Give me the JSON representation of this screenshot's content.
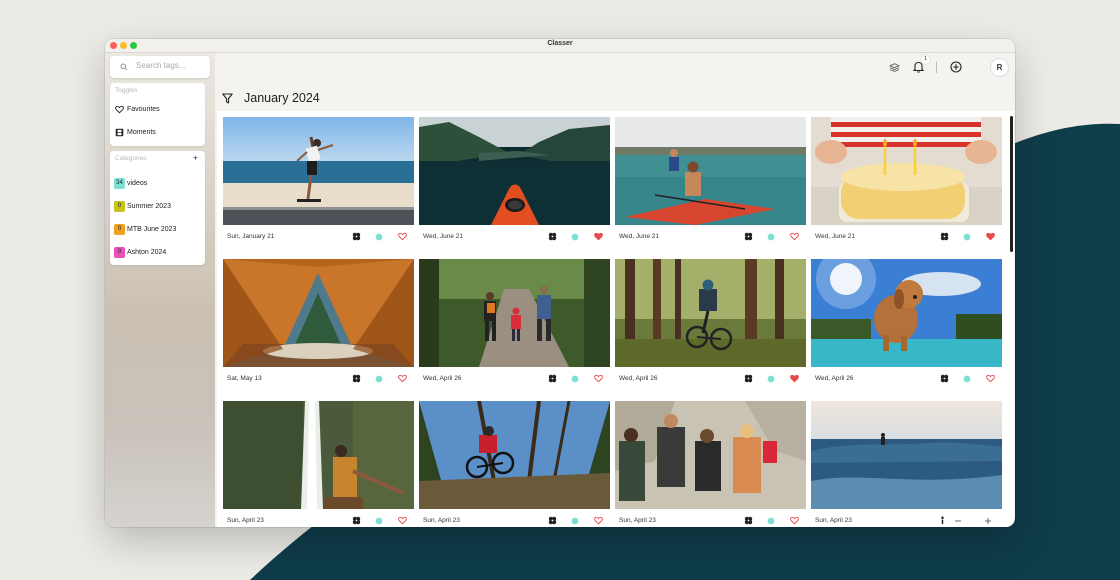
{
  "window": {
    "title": "Classer"
  },
  "search": {
    "placeholder": "Search tags..."
  },
  "toggles": {
    "title": "Toggles",
    "items": [
      {
        "label": "Favourites",
        "icon": "heart-icon"
      },
      {
        "label": "Moments",
        "icon": "film-icon"
      }
    ]
  },
  "categories": {
    "title": "Categories",
    "add_label": "+",
    "items": [
      {
        "count": "34",
        "label": "videos",
        "color": "#7ee0d4"
      },
      {
        "count": "0",
        "label": "Summer 2023",
        "color": "#c9c21a"
      },
      {
        "count": "0",
        "label": "MTB June 2023",
        "color": "#f0a020"
      },
      {
        "count": "0",
        "label": "Ashton 2024",
        "color": "#e84fb8"
      }
    ]
  },
  "topbar": {
    "notification_count": "1",
    "avatar_initial": "R"
  },
  "main": {
    "heading": "January 2024"
  },
  "accent": {
    "teal": "#7ee0d4",
    "heart": "#e84a4a",
    "dark_teal": "#0f3d4a"
  },
  "gallery": {
    "items": [
      {
        "date": "Sun, January 21",
        "favourite": false,
        "scene": "skateboarder-beach"
      },
      {
        "date": "Wed, June 21",
        "favourite": true,
        "scene": "kayak-fjord"
      },
      {
        "date": "Wed, June 21",
        "favourite": false,
        "scene": "paddleboard-family"
      },
      {
        "date": "Wed, June 21",
        "favourite": true,
        "scene": "birthday-cake"
      },
      {
        "date": "Sat, May 13",
        "favourite": false,
        "scene": "tent-forest"
      },
      {
        "date": "Wed, April 26",
        "favourite": false,
        "scene": "family-walk-forest"
      },
      {
        "date": "Wed, April 26",
        "favourite": true,
        "scene": "mtb-forest"
      },
      {
        "date": "Wed, April 26",
        "favourite": false,
        "scene": "dog-pool"
      },
      {
        "date": "Sun, April 23",
        "favourite": false,
        "scene": "waterfall-hiker"
      },
      {
        "date": "Sun, April 23",
        "favourite": false,
        "scene": "mtb-jump"
      },
      {
        "date": "Sun, April 23",
        "favourite": false,
        "scene": "friends-hiking"
      },
      {
        "date": "Sun, April 23",
        "favourite": false,
        "scene": "surfer-wave"
      }
    ]
  }
}
